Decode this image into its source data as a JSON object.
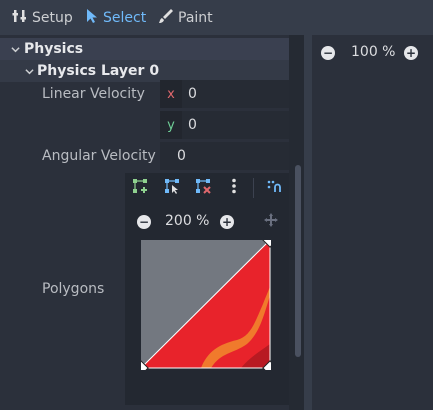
{
  "toolbar": {
    "setup_label": "Setup",
    "select_label": "Select",
    "paint_label": "Paint"
  },
  "inspector": {
    "section_title": "Physics",
    "layer_title": "Physics Layer 0",
    "linear_velocity": {
      "label": "Linear Velocity",
      "x_axis": "x",
      "x_value": "0",
      "y_axis": "y",
      "y_value": "0"
    },
    "angular_velocity": {
      "label": "Angular Velocity",
      "value": "0"
    },
    "polygons": {
      "label": "Polygons",
      "zoom_text": "200 %"
    }
  },
  "preview": {
    "zoom_text": "100 %"
  },
  "colors": {
    "accent": "#70bafa",
    "axis_x": "#e0686d",
    "axis_y": "#6fcf97",
    "tile_red": "#e8232b",
    "tile_gray": "#737880"
  },
  "icons": [
    "setup-icon",
    "select-icon",
    "paint-icon",
    "add-point-icon",
    "edit-point-icon",
    "remove-point-icon",
    "more-options-icon",
    "snap-icon",
    "zoom-out-icon",
    "zoom-in-icon",
    "pan-icon"
  ]
}
